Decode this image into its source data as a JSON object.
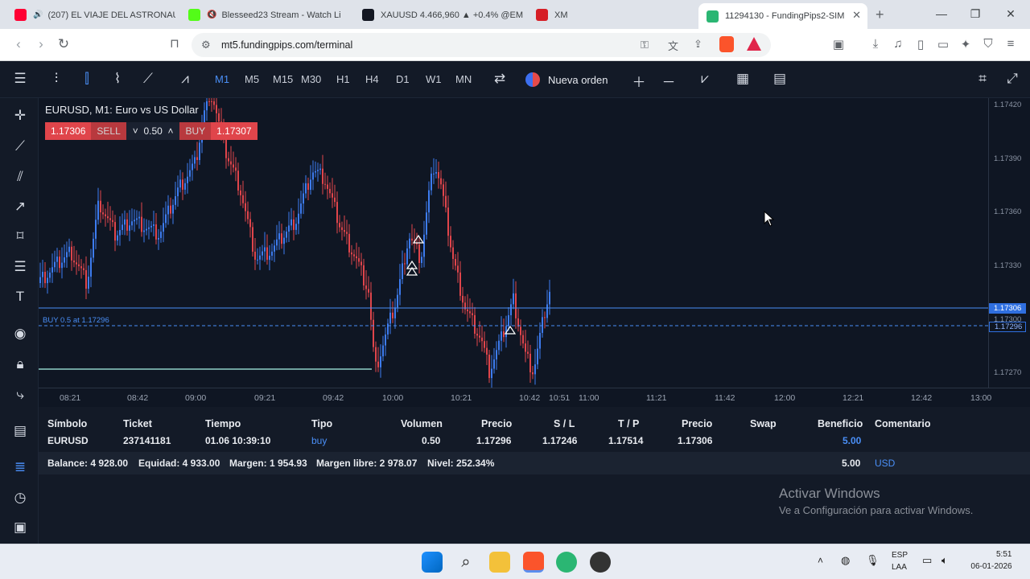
{
  "browser": {
    "tabs": [
      {
        "title": "(207) EL VIAJE DEL ASTRONAU",
        "icon": "youtube-icon",
        "color": "#ff0033"
      },
      {
        "title": "Blesseed23 Stream - Watch Li",
        "icon": "kick-icon",
        "color": "#53fc18"
      },
      {
        "title": "XAUUSD 4.466,960 ▲ +0.4% @EM",
        "icon": "tradingview-icon",
        "color": "#131722"
      },
      {
        "title": "XM",
        "icon": "xm-icon",
        "color": "#d61e26"
      },
      {
        "title": "11294130 - FundingPips2-SIM",
        "icon": "fundingpips-icon",
        "color": "#2bb673"
      }
    ],
    "new_tab": "+",
    "url": "mt5.fundingpips.com/terminal"
  },
  "toolbar": {
    "timeframes": [
      "M1",
      "M5",
      "M15",
      "M30",
      "H1",
      "H4",
      "D1",
      "W1",
      "MN"
    ],
    "active_timeframe": "M1",
    "new_order_label": "Nueva orden"
  },
  "chart": {
    "symbol_title": "EURUSD, M1: Euro vs US Dollar",
    "sell_price": "1.17306",
    "sell_label": "SELL",
    "volume": "0.50",
    "buy_label": "BUY",
    "buy_price": "1.17307",
    "position_line_label": "BUY 0.5 at 1.17296",
    "price_ticks": [
      "1.17420",
      "1.17390",
      "1.17360",
      "1.17330",
      "1.17300",
      "1.17270"
    ],
    "bid_tag": "1.17306",
    "position_tag": "1.17296",
    "time_ticks": [
      "08:21",
      "08:42",
      "09:00",
      "09:21",
      "09:42",
      "10:00",
      "10:21",
      "10:42",
      "10:51",
      "11:00",
      "11:21",
      "11:42",
      "12:00",
      "12:21",
      "12:42",
      "13:00"
    ],
    "colors": {
      "bull": "#3d7cf0",
      "bear": "#e0454b",
      "line": "#4a8ff7"
    }
  },
  "positions": {
    "headers": [
      "Símbolo",
      "Ticket",
      "Tiempo",
      "Tipo",
      "Volumen",
      "Precio",
      "S / L",
      "T / P",
      "Precio",
      "Swap",
      "Beneficio",
      "Comentario"
    ],
    "rows": [
      {
        "symbol": "EURUSD",
        "ticket": "237141181",
        "time": "01.06 10:39:10",
        "type": "buy",
        "volume": "0.50",
        "price_open": "1.17296",
        "sl": "1.17246",
        "tp": "1.17514",
        "price_current": "1.17306",
        "swap": "",
        "profit": "5.00",
        "comment": ""
      }
    ],
    "summary": {
      "balance": "Balance: 4 928.00",
      "equity": "Equidad: 4 933.00",
      "margin": "Margen: 1 954.93",
      "free_margin": "Margen libre: 2 978.07",
      "level": "Nivel: 252.34%",
      "profit": "5.00",
      "currency": "USD"
    }
  },
  "watermark": {
    "line1": "Activar Windows",
    "line2": "Ve a Configuración para activar Windows."
  },
  "taskbar": {
    "lang": "ESP",
    "layout": "LAA",
    "time": "5:51",
    "date": "06-01-2026"
  }
}
